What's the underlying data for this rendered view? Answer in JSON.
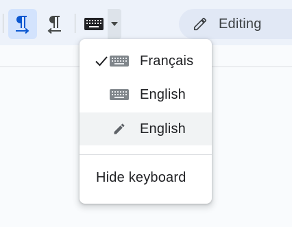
{
  "toolbar": {
    "buttons": [
      {
        "name": "ltr-text-direction",
        "icon": "pilcrow-ltr-icon",
        "active": true
      },
      {
        "name": "rtl-text-direction",
        "icon": "pilcrow-rtl-icon",
        "active": false
      },
      {
        "name": "input-tools",
        "icon": "keyboard-icon",
        "active": false
      }
    ],
    "mode": {
      "label": "Editing",
      "icon": "pencil-icon"
    }
  },
  "input_menu": {
    "items": [
      {
        "label": "Français",
        "icon": "keyboard-icon",
        "checked": true
      },
      {
        "label": "English",
        "icon": "keyboard-icon",
        "checked": false
      },
      {
        "label": "English",
        "icon": "pencil-icon",
        "checked": false,
        "highlighted": true
      }
    ],
    "hide_label": "Hide keyboard"
  },
  "colors": {
    "toolbar_bg": "#edf2fa",
    "active_button_bg": "#d3e3fd",
    "active_icon": "#0b57d0",
    "editing_pill_bg": "#e1e8f5",
    "menu_hover_bg": "#f1f3f4"
  }
}
